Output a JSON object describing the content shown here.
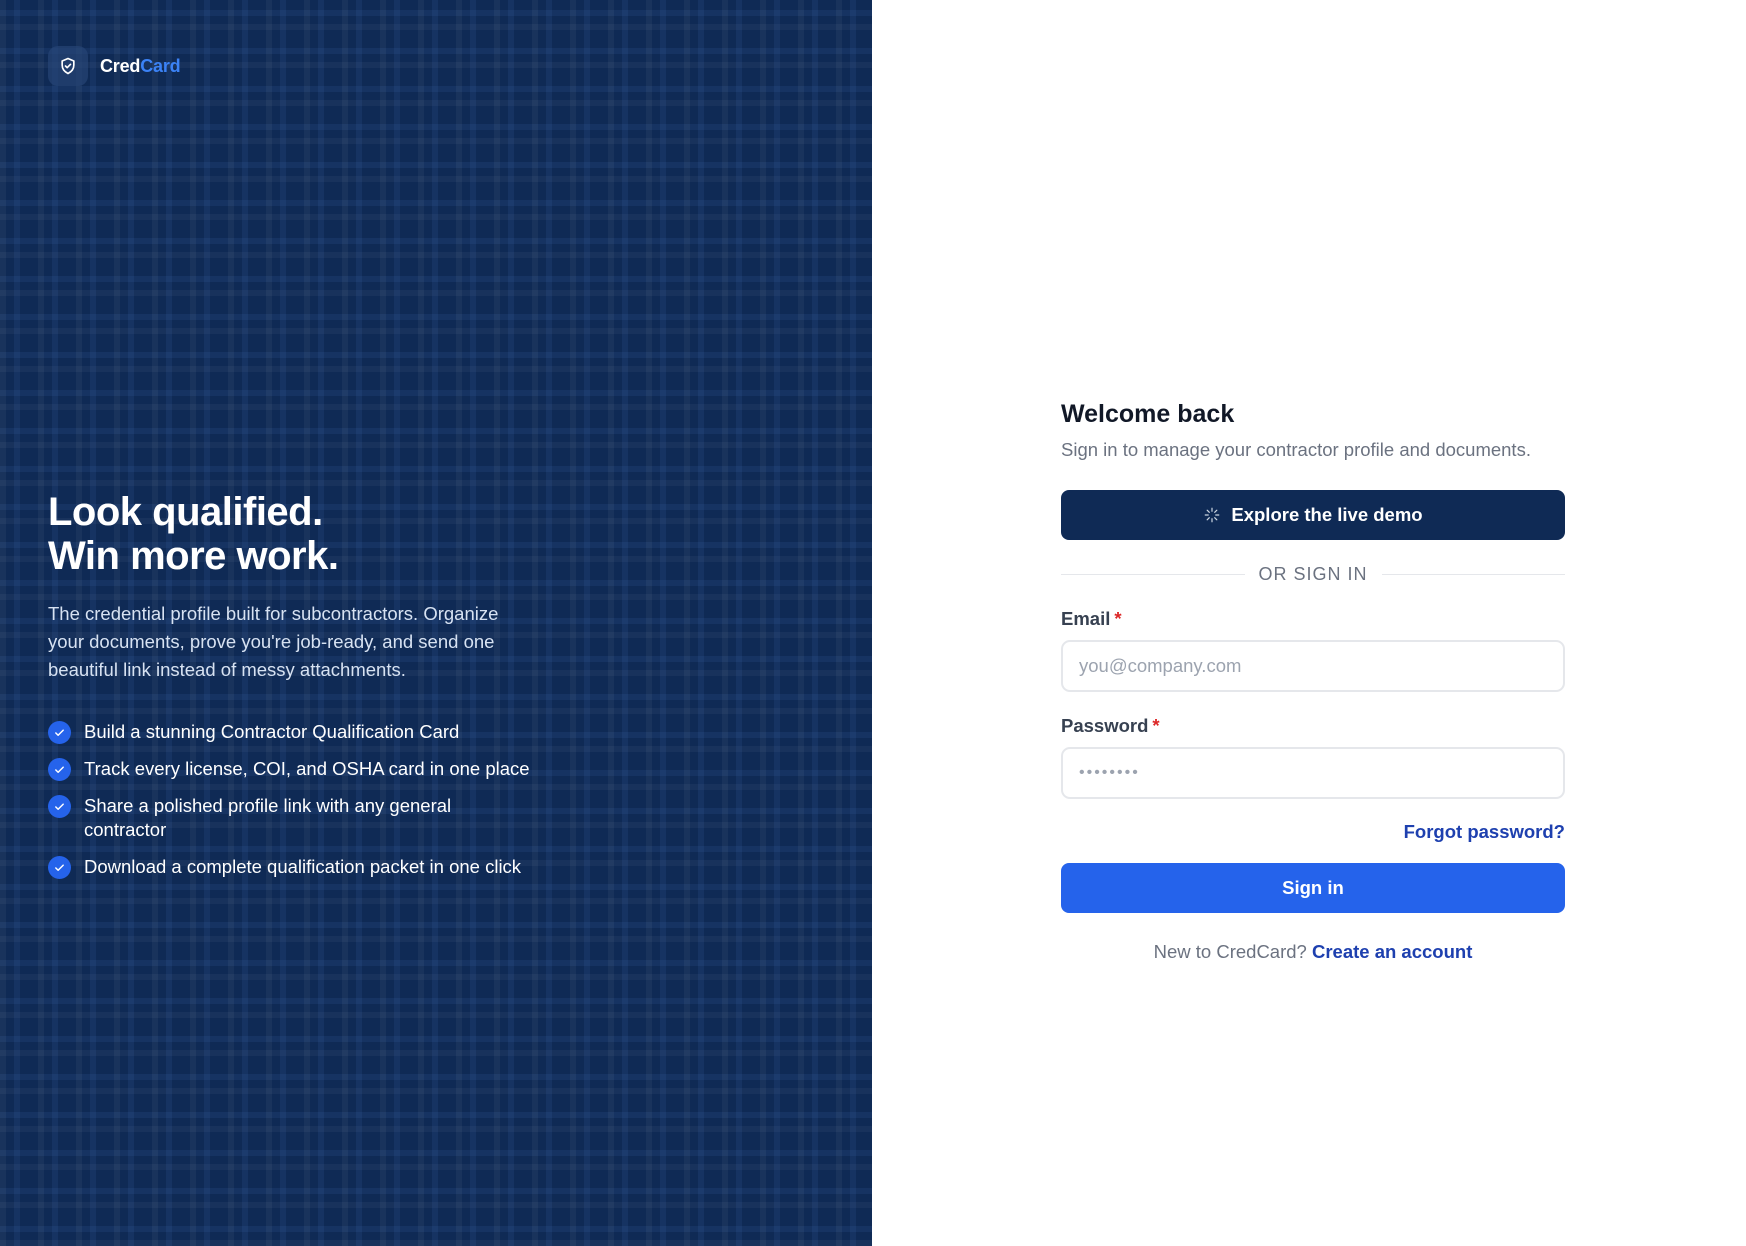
{
  "brand": {
    "name_part1": "Cred",
    "name_part2": "Card",
    "logo_icon": "shield-check-icon",
    "accent_color": "#3b82f6"
  },
  "hero": {
    "title_line1": "Look qualified.",
    "title_line2": "Win more work.",
    "description": "The credential profile built for subcontractors. Organize your documents, prove you're job-ready, and send one beautiful link instead of messy attachments.",
    "features": [
      "Build a stunning Contractor Qualification Card",
      "Track every license, COI, and OSHA card in one place",
      "Share a polished profile link with any general contractor",
      "Download a complete qualification packet in one click"
    ],
    "feature_icon": "check-icon",
    "panel_color": "#0f2a55"
  },
  "form": {
    "title": "Welcome back",
    "subtitle": "Sign in to manage your contractor profile and documents.",
    "demo_button": "Explore the live demo",
    "demo_icon": "sparkle-icon",
    "divider": "OR SIGN IN",
    "email_label": "Email",
    "email_placeholder": "you@company.com",
    "password_label": "Password",
    "password_value": "••••••••",
    "required_mark": "*",
    "forgot_link": "Forgot password?",
    "signin_button": "Sign in",
    "footer_text": "New to CredCard?",
    "footer_link": "Create an account",
    "primary_color": "#2563eb"
  }
}
